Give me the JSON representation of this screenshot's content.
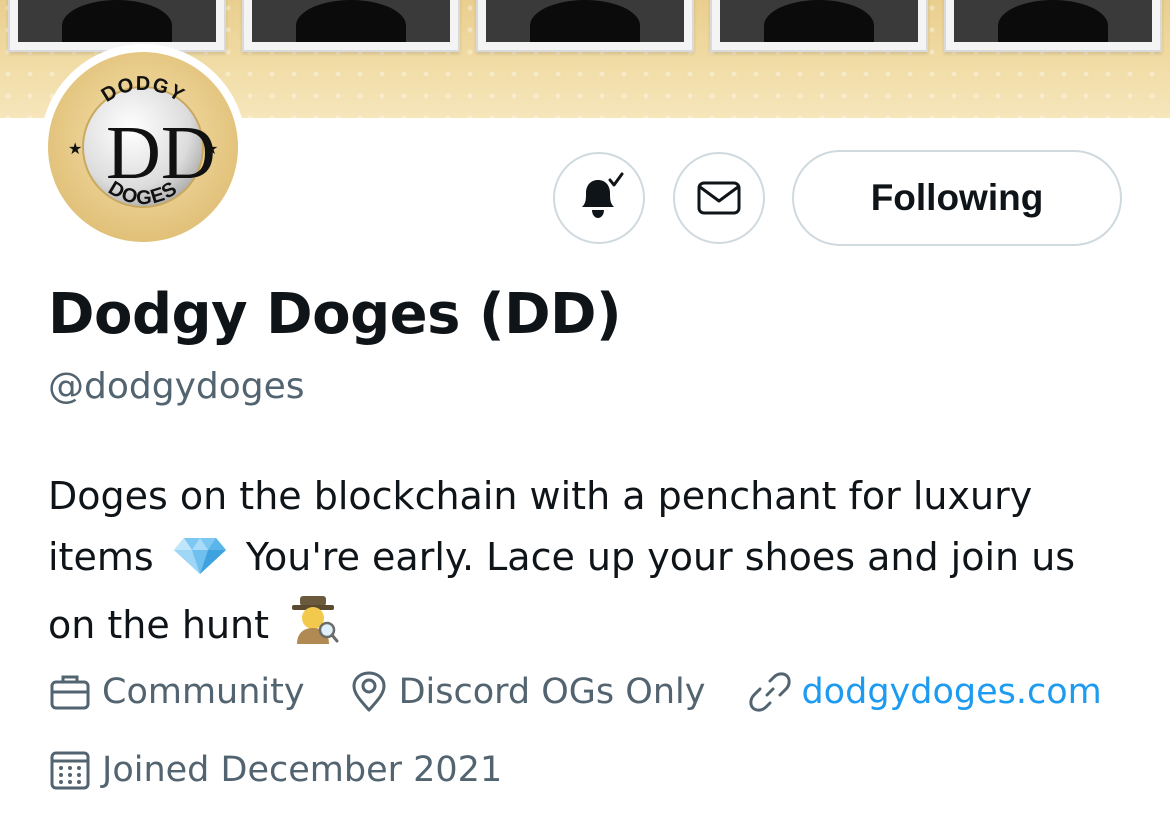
{
  "banner": {
    "frames": 5
  },
  "avatar": {
    "logo_text_top": "DODGY",
    "logo_text_bottom": "DOGES",
    "logo_monogram": "DD",
    "ring_color": "#e7c987"
  },
  "actions": {
    "notifications_icon": "bell-check-icon",
    "message_icon": "envelope-icon",
    "follow_label": "Following"
  },
  "profile": {
    "display_name": "Dodgy Doges (DD)",
    "handle": "@dodgydoges",
    "bio_line1": "Doges on the blockchain with a penchant for luxury",
    "bio_line2_a": "items",
    "bio_line2_b": "You're early. Lace up your shoes and join us",
    "bio_line3": "on the hunt",
    "bio_emoji_1": "gem-stone-emoji",
    "bio_emoji_2": "detective-emoji"
  },
  "meta": {
    "category_icon": "briefcase-icon",
    "category": "Community",
    "location_icon": "location-pin-icon",
    "location": "Discord OGs Only",
    "link_icon": "link-icon",
    "website": "dodgydoges.com",
    "joined_icon": "calendar-icon",
    "joined": "Joined December 2021"
  },
  "colors": {
    "text_primary": "#0f1419",
    "text_secondary": "#536471",
    "link": "#1d9bf0",
    "button_border": "#cfd9de",
    "banner_gold": "#ebd294"
  }
}
